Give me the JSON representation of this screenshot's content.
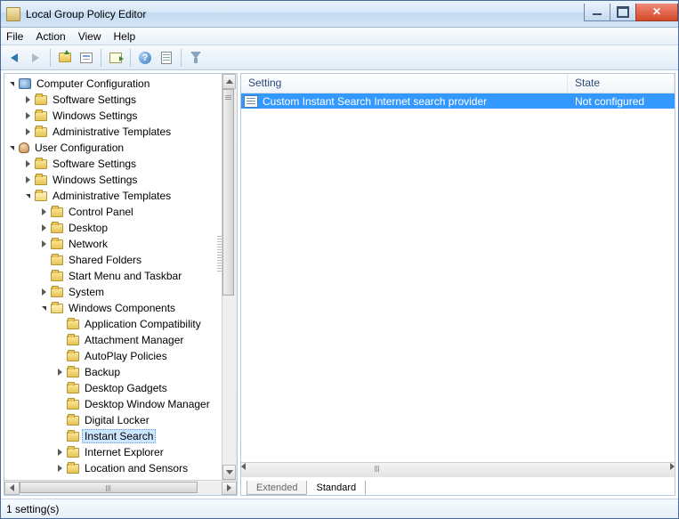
{
  "window": {
    "title": "Local Group Policy Editor"
  },
  "menu": {
    "file": "File",
    "action": "Action",
    "view": "View",
    "help": "Help"
  },
  "tree": {
    "computer": "Computer Configuration",
    "user": "User Configuration",
    "software": "Software Settings",
    "windows": "Windows Settings",
    "admin": "Administrative Templates",
    "control_panel": "Control Panel",
    "desktop": "Desktop",
    "network": "Network",
    "shared_folders": "Shared Folders",
    "start_menu": "Start Menu and Taskbar",
    "system": "System",
    "win_components": "Windows Components",
    "app_compat": "Application Compatibility",
    "attach_mgr": "Attachment Manager",
    "autoplay": "AutoPlay Policies",
    "backup": "Backup",
    "gadgets": "Desktop Gadgets",
    "dwm": "Desktop Window Manager",
    "digital_locker": "Digital Locker",
    "instant_search": "Instant Search",
    "ie": "Internet Explorer",
    "location": "Location and Sensors"
  },
  "list": {
    "col_setting": "Setting",
    "col_state": "State",
    "rows": [
      {
        "setting": "Custom Instant Search Internet search provider",
        "state": "Not configured"
      }
    ]
  },
  "tabs": {
    "extended": "Extended",
    "standard": "Standard"
  },
  "status": {
    "text": "1 setting(s)"
  }
}
